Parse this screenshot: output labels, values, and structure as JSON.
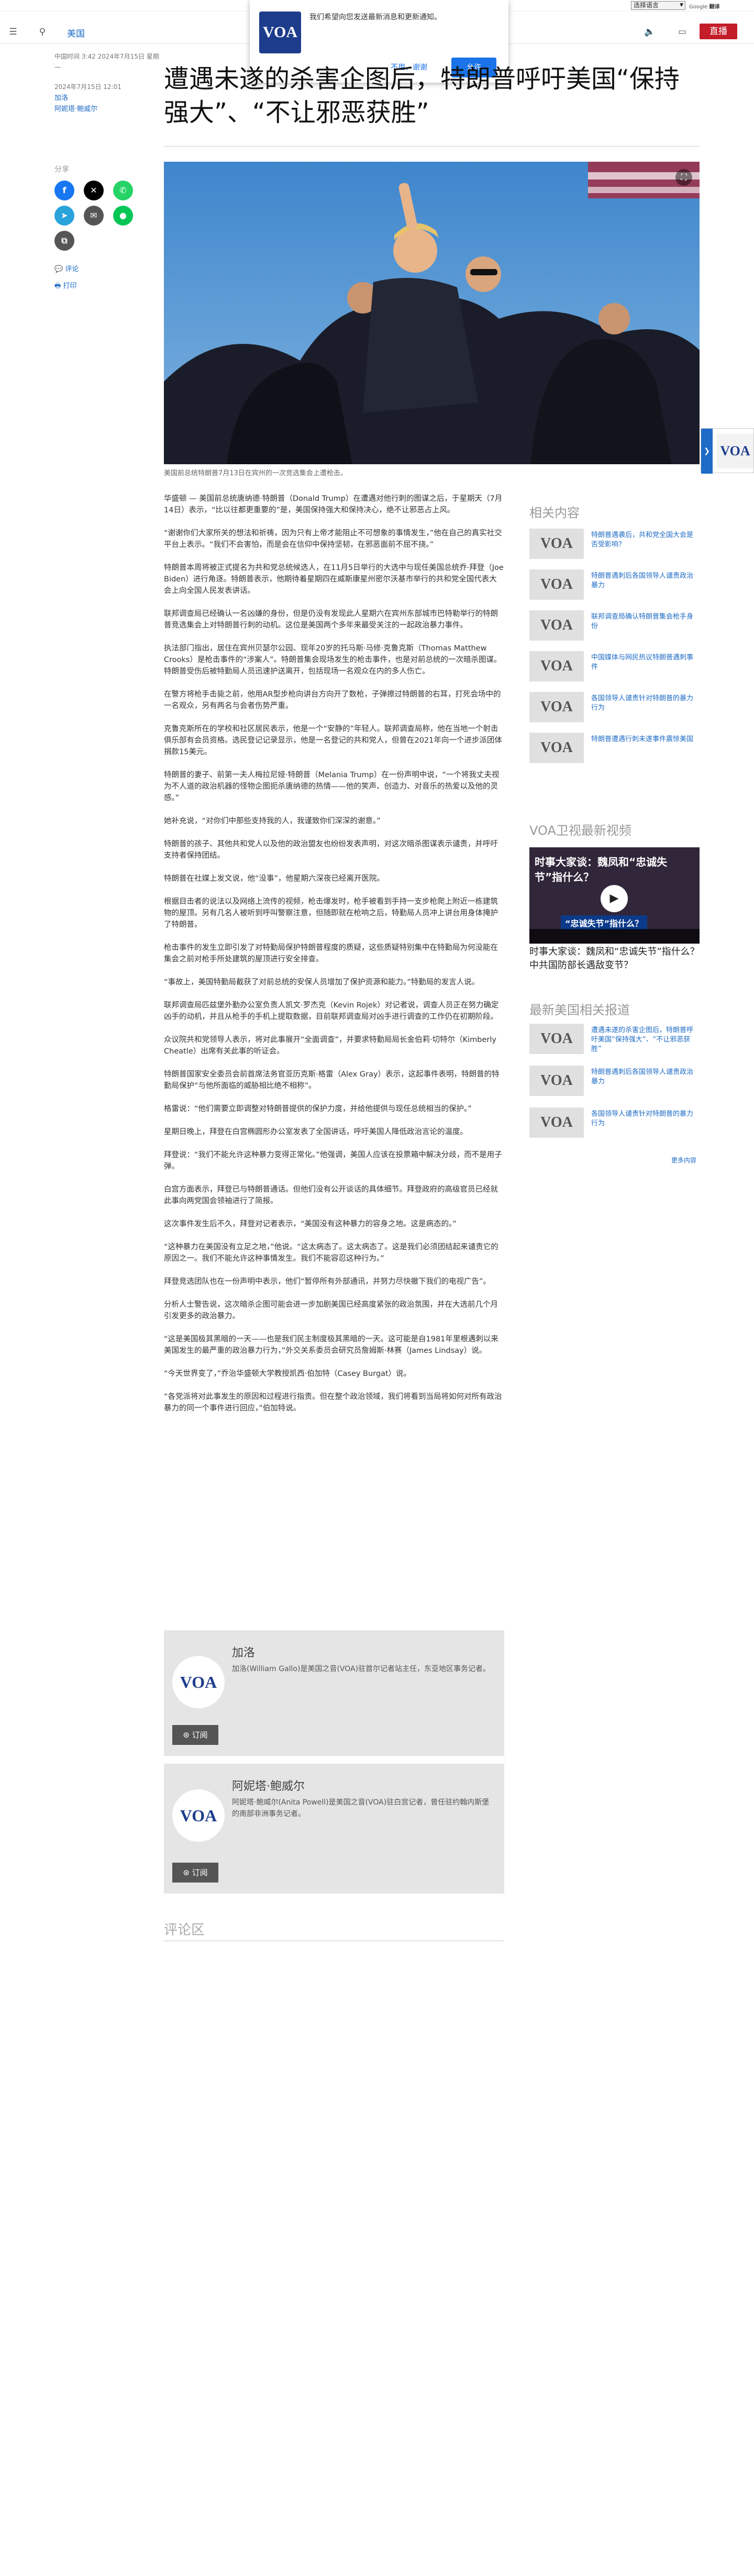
{
  "topbar": {
    "language_select": "选择语言",
    "translate_label": "Google",
    "translate_brand": "翻译"
  },
  "header": {
    "menu_icon": "menu-icon",
    "search_icon": "search-icon",
    "nav_label": "美国",
    "audio_icon": "audio-icon",
    "live_label": "直播"
  },
  "popup": {
    "logo_text": "VOA",
    "message": "我们希望向您发送最新消息和更新通知。",
    "deny_label": "不用，谢谢",
    "allow_label": "允许"
  },
  "article": {
    "timestamp_line": "中国时间 3:42 2024年7月15日 星期一",
    "date_line": "2024年7月15日 12:01",
    "author1": "加洛",
    "author2": "阿妮塔·鲍威尔",
    "title": "遭遇未遂的杀害企图后，特朗普呼吁美国“保持强大”、“不让邪恶获胜”",
    "share_label": "分享",
    "comment_label": "评论",
    "print_label": "打印",
    "caption": "美国前总统特朗普7月13日在宾州的一次竞选集会上遭枪击。",
    "paragraphs": [
      "华盛顿 — 美国前总统唐纳德·特朗普（Donald Trump）在遭遇对他行刺的图谋之后，于星期天（7月14日）表示，“比以往都更重要的”是，美国保持强大和保持决心，绝不让邪恶占上风。",
      "“谢谢你们大家所关的想法和祈祷，因为只有上帝才能阻止不可想象的事情发生，”他在自己的真实社交平台上表示。“我们不会害怕，而是会在信仰中保持坚韧，在邪恶面前不屈不挠。”",
      "特朗普本周将被正式提名为共和党总统候选人，在11月5日举行的大选中与现任美国总统乔·拜登（Joe Biden）进行角逐。特朗普表示，他期待着星期四在威斯康星州密尔沃基市举行的共和党全国代表大会上向全国人民发表讲话。",
      "联邦调查局已经确认一名凶嫌的身份，但是仍没有发现此人星期六在宾州东部城市巴特勒举行的特朗普竞选集会上对特朗普行刺的动机。这位是美国两个多年来最受关注的一起政治暴力事件。",
      "执法部门指出，居住在宾州贝瑟尔公园、现年20岁的托马斯·马修·克鲁克斯（Thomas Matthew Crooks）是枪击事件的“涉案人”。特朗普集会现场发生的枪击事件，也是对前总统的一次暗杀图谋。特朗普受伤后被特勤局人员迅速护送离开，包括现场一名观众在内的多人伤亡。",
      "在警方将枪手击毙之前，他用AR型步枪向讲台方向开了数枪，子弹擦过特朗普的右耳，打死会场中的一名观众，另有两名与会者伤势严重。",
      "克鲁克斯所在的学校和社区居民表示，他是一个“安静的”年轻人。联邦调查局称，他在当地一个射击俱乐部有会员资格。选民登记记录显示，他是一名登记的共和党人，但曾在2021年向一个进步派团体捐款15美元。",
      "特朗普的妻子、前第一夫人梅拉尼娅·特朗普（Melania Trump）在一份声明中说，“一个将我丈夫视为不人道的政治机器的怪物企图扼杀唐纳德的热情——他的笑声、创造力、对音乐的热爱以及他的灵感。”",
      "她补充说，“对你们中那些支持我的人，我谨致你们深深的谢意。”",
      "特朗普的孩子、其他共和党人以及他的政治盟友也纷纷发表声明，对这次暗杀图谋表示谴责，并呼吁支持者保持团结。",
      "特朗普在社媒上发文说，他“没事”，他星期六深夜已经离开医院。",
      "根据目击者的说法以及网络上流传的视频，枪击爆发时，枪手被看到手持一支步枪爬上附近一栋建筑物的屋顶。另有几名人被听到呼叫警察注意，但随即就在枪响之后，特勤局人员冲上讲台用身体掩护了特朗普。",
      "枪击事件的发生立即引发了对特勤局保护特朗普程度的质疑，这些质疑特别集中在特勤局为何没能在集会之前对枪手所处建筑的屋顶进行安全排查。",
      "“事故上，美国特勤局截获了对前总统的安保人员增加了保护资源和能力。”特勤局的发言人说。",
      "联邦调查局匹兹堡外勤办公室负责人凯文·罗杰克（Kevin Rojek）对记者说，调查人员正在努力确定凶手的动机，并且从枪手的手机上提取数据，目前联邦调查局对凶手进行调查的工作仍在初期阶段。",
      "众议院共和党领导人表示，将对此事展开“全面调查”，并要求特勤局局长金伯莉·切特尔（Kimberly Cheatle）出席有关此事的听证会。",
      "特朗普国家安全委员会前首席法务官亚历克斯·格雷（Alex Gray）表示，这起事件表明，特朗普的特勤局保护“与他所面临的威胁相比绝不相称”。",
      "格雷说：“他们需要立即调整对特朗普提供的保护力度，并给他提供与现任总统相当的保护。”",
      "星期日晚上，拜登在白宫椭圆形办公室发表了全国讲话，呼吁美国人降低政治言论的温度。",
      "拜登说：“我们不能允许这种暴力变得正常化。”他强调，美国人应该在投票箱中解决分歧，而不是用子弹。",
      "白宫方面表示，拜登已与特朗普通话。但他们没有公开谈话的具体细节。拜登政府的高级官员已经就此事向两党国会领袖进行了简报。",
      "这次事件发生后不久，拜登对记者表示，“美国没有这种暴力的容身之地。这是病态的。”",
      "“这种暴力在美国没有立足之地，”他说。“这太病态了。这太病态了。这是我们必须团结起来谴责它的原因之一。我们不能允许这种事情发生。我们不能容忍这种行为。”",
      "拜登竞选团队也在一份声明中表示，他们“暂停所有外部通讯，并努力尽快撤下我们的电视广告”。",
      "分析人士警告说，这次暗杀企图可能会进一步加剧美国已经高度紧张的政治氛围，并在大选前几个月引发更多的政治暴力。",
      "“这是美国极其黑暗的一天——也是我们民主制度极其黑暗的一天。这可能是自1981年里根遇刺以来美国发生的最严重的政治暴力行为，”外交关系委员会研究员詹姆斯·林赛（James Lindsay）说。",
      "“今天世界变了，”乔治华盛顿大学教授凯西·伯加特（Casey Burgat）说。",
      "“各党派将对此事发生的原因和过程进行指责。但在整个政治领域，我们将看到当局将如何对所有政治暴力的同一个事件进行回应，”伯加特说。"
    ]
  },
  "authors": [
    {
      "name": "加洛",
      "logo": "VOA",
      "bio": "加洛(William Gallo)是美国之音(VOA)驻首尔记者站主任，东亚地区事务记者。",
      "subscribe": "订阅"
    },
    {
      "name": "阿妮塔·鲍威尔",
      "logo": "VOA",
      "bio": "阿妮塔·鲍威尔(Anita Powell)是美国之音(VOA)驻白宫记者，曾任驻约翰内斯堡的南部非洲事务记者。",
      "subscribe": "订阅"
    }
  ],
  "comments_heading": "评论区",
  "sidebar": {
    "related_heading": "相关内容",
    "related": [
      {
        "logo": "VOA",
        "text": "特朗普遇袭后，共和党全国大会是否受影响？"
      },
      {
        "logo": "VOA",
        "text": "特朗普遇刺后各国领导人谴责政治暴力"
      },
      {
        "logo": "VOA",
        "text": "联邦调查局确认特朗普集会枪手身份"
      },
      {
        "logo": "VOA",
        "text": "中国媒体与网民热议特朗普遇刺事件"
      },
      {
        "logo": "VOA",
        "text": "各国领导人谴责针对特朗普的暴力行为"
      },
      {
        "logo": "VOA",
        "text": "特朗普遭遇行刺未遂事件震惊美国"
      }
    ],
    "video_heading": "VOA卫视最新视频",
    "video_title": "时事大家谈：魏凤和“忠诚失节”指什么？",
    "video_banner": "“忠诚失节”指什么？",
    "video_caption": "时事大家谈：魏凤和“忠诚失节”指什么？中共国防部长遇敌变节？",
    "latest_heading": "最新美国相关报道",
    "latest": [
      {
        "logo": "VOA",
        "text": "遭遇未遂的杀害企图后，特朗普呼吁美国“保持强大”、“不让邪恶获胜”"
      },
      {
        "logo": "VOA",
        "text": "特朗普遇刺后各国领导人谴责政治暴力"
      },
      {
        "logo": "VOA",
        "text": "各国领导人谴责针对特朗普的暴力行为"
      }
    ],
    "more_label": "更多内容"
  },
  "sidetab": {
    "logo": "VOA"
  }
}
